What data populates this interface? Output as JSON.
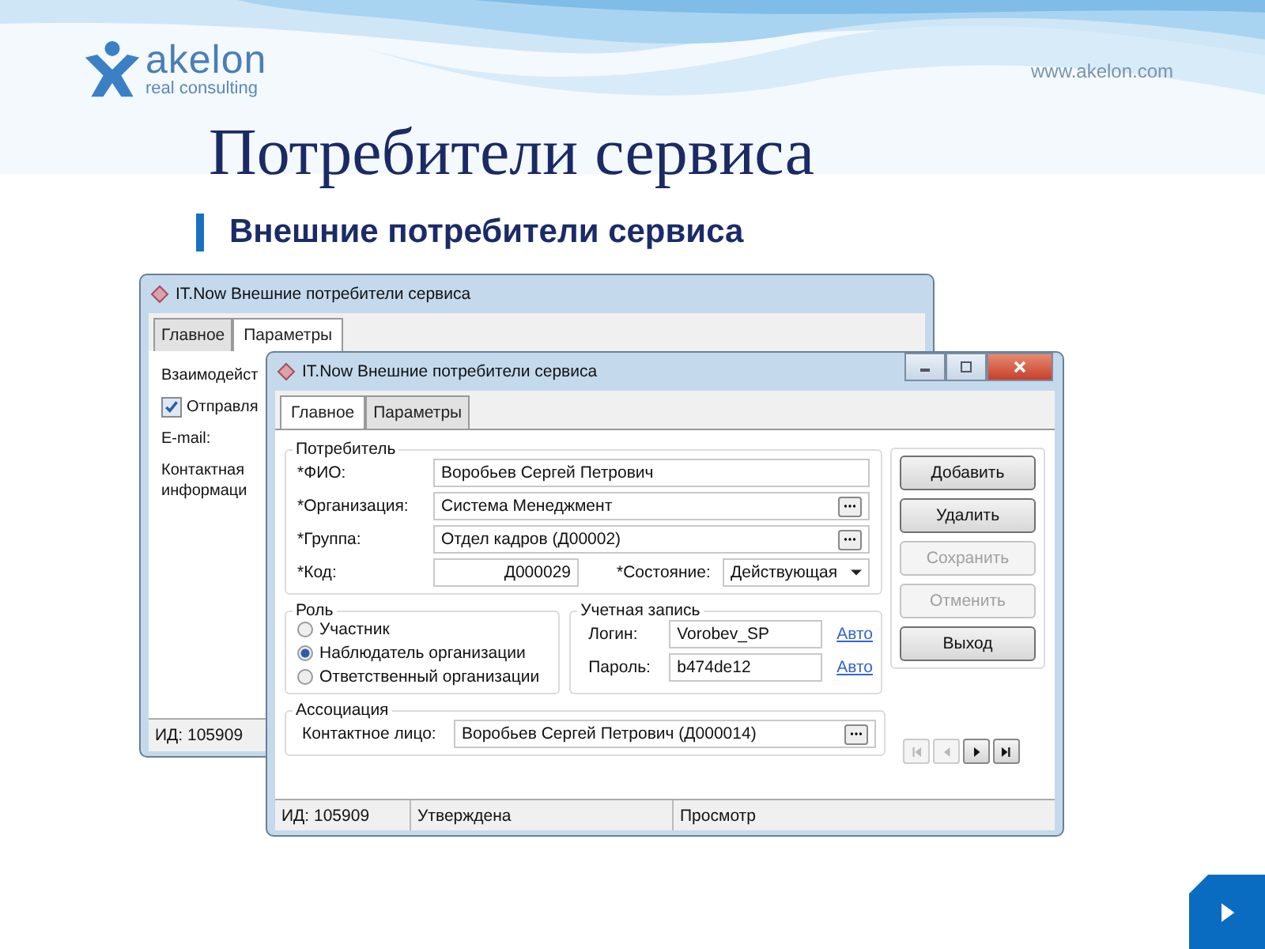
{
  "slide": {
    "logo": {
      "name": "akelon",
      "tagline": "real  consulting"
    },
    "website": "www.akelon.com",
    "title": "Потребители сервиса",
    "subtitle": "Внешние потребители сервиса"
  },
  "back_window": {
    "title": "IT.Now Внешние потребители сервиса",
    "tabs": [
      {
        "label": "Главное",
        "selected": false
      },
      {
        "label": "Параметры",
        "selected": true
      }
    ],
    "group_legend": "Взаимодейст",
    "checkbox": {
      "label": "Отправля",
      "checked": true
    },
    "email_label": "E-mail:",
    "info_lines": [
      "Контактная",
      "информаци"
    ],
    "status": "ИД: 105909"
  },
  "front_window": {
    "title": "IT.Now Внешние потребители сервиса",
    "tabs": [
      {
        "label": "Главное",
        "selected": true
      },
      {
        "label": "Параметры",
        "selected": false
      }
    ],
    "consumer": {
      "legend": "Потребитель",
      "fields": [
        {
          "kind": "text",
          "label": "*ФИО:",
          "value": "Воробьев Сергей Петрович"
        },
        {
          "kind": "lookup",
          "label": "*Организация:",
          "value": "Система Менеджмент"
        },
        {
          "kind": "lookup",
          "label": "*Группа:",
          "value": "Отдел кадров (Д00002)"
        }
      ],
      "code": {
        "label": "*Код:",
        "value": "Д000029"
      },
      "state": {
        "label": "*Состояние:",
        "value": "Действующая"
      }
    },
    "buttons": [
      {
        "label": "Добавить",
        "disabled": false
      },
      {
        "label": "Удалить",
        "disabled": false
      },
      {
        "label": "Сохранить",
        "disabled": true
      },
      {
        "label": "Отменить",
        "disabled": true
      },
      {
        "label": "Выход",
        "disabled": false
      }
    ],
    "role": {
      "legend": "Роль",
      "options": [
        {
          "label": "Участник",
          "selected": false
        },
        {
          "label": "Наблюдатель организации",
          "selected": true
        },
        {
          "label": "Ответственный организации",
          "selected": false
        }
      ]
    },
    "account": {
      "legend": "Учетная запись",
      "rows": [
        {
          "label": "Логин:",
          "value": "Vorobev_SP",
          "link": "Авто"
        },
        {
          "label": "Пароль:",
          "value": "b474de12",
          "link": "Авто"
        }
      ]
    },
    "association": {
      "legend": "Ассоциация",
      "label": "Контактное лицо:",
      "value": "Воробьев Сергей Петрович (Д000014)"
    },
    "nav": [
      {
        "kind": "first",
        "disabled": true
      },
      {
        "kind": "prev",
        "disabled": true
      },
      {
        "kind": "next",
        "disabled": false
      },
      {
        "kind": "last",
        "disabled": false
      }
    ],
    "status_bar": [
      "ИД: 105909",
      "Утверждена",
      "Просмотр"
    ]
  }
}
